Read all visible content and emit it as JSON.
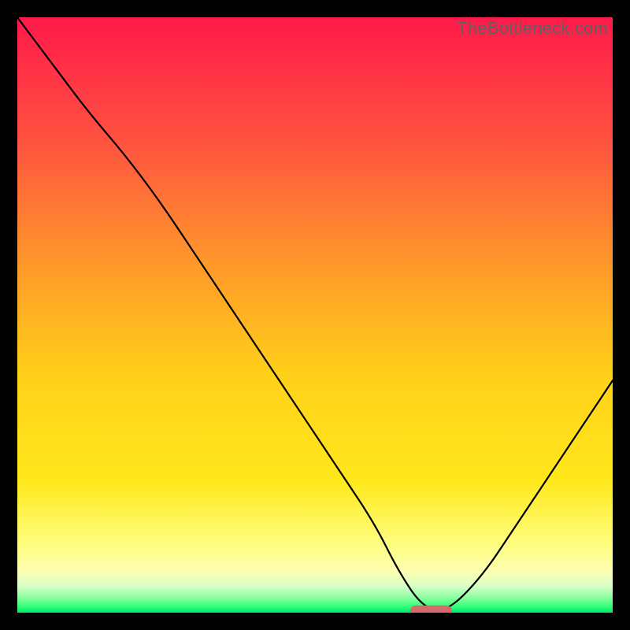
{
  "watermark": "TheBottleneck.com",
  "chart_data": {
    "type": "line",
    "title": "",
    "xlabel": "",
    "ylabel": "",
    "xlim": [
      0,
      100
    ],
    "ylim": [
      0,
      100
    ],
    "gradient_stops": [
      {
        "offset": 0.0,
        "color": "#ff1a4a"
      },
      {
        "offset": 0.2,
        "color": "#ff5040"
      },
      {
        "offset": 0.42,
        "color": "#ff9a2a"
      },
      {
        "offset": 0.6,
        "color": "#ffd019"
      },
      {
        "offset": 0.78,
        "color": "#ffe81c"
      },
      {
        "offset": 0.88,
        "color": "#fffd7a"
      },
      {
        "offset": 0.93,
        "color": "#fdffb0"
      },
      {
        "offset": 0.955,
        "color": "#d9ffc8"
      },
      {
        "offset": 0.975,
        "color": "#8aff9e"
      },
      {
        "offset": 0.99,
        "color": "#2eff7a"
      },
      {
        "offset": 1.0,
        "color": "#00e766"
      }
    ],
    "series": [
      {
        "name": "bottleneck-curve",
        "x": [
          0,
          6,
          12,
          18,
          24,
          30,
          36,
          42,
          48,
          54,
          60,
          64,
          68,
          72,
          78,
          84,
          90,
          96,
          100
        ],
        "y": [
          100,
          92,
          84,
          77,
          69,
          60,
          51,
          42,
          33,
          24,
          15,
          7,
          1,
          0,
          6,
          15,
          24,
          33,
          39
        ]
      }
    ],
    "marker": {
      "name": "optimal-range",
      "x_start": 66,
      "x_end": 73,
      "y": 0.3,
      "color": "#d46a6a"
    }
  }
}
